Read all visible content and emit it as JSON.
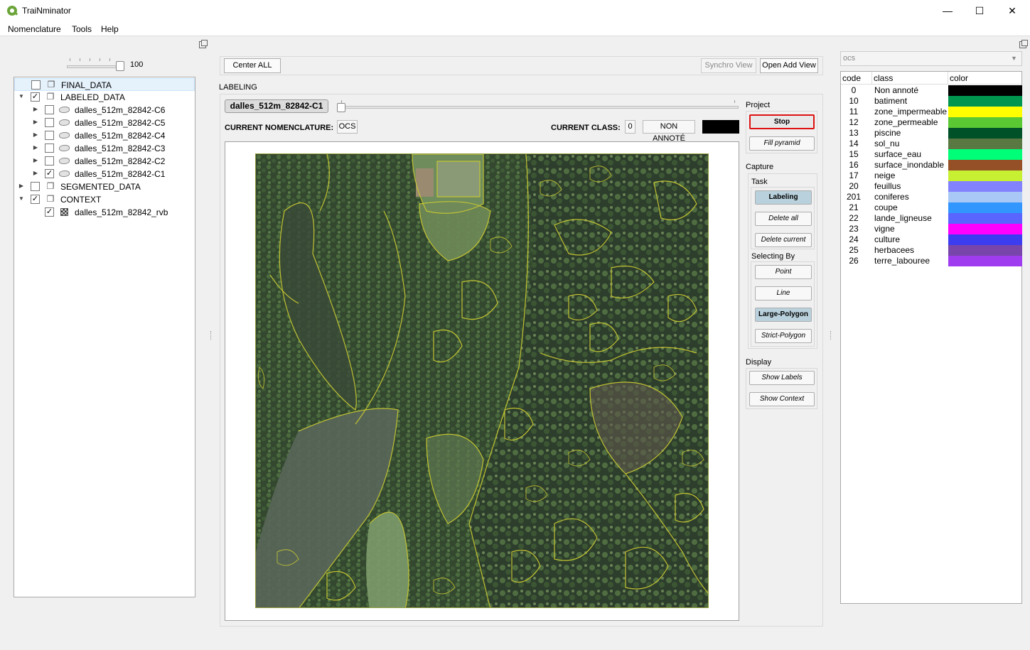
{
  "window": {
    "title": "TraiNminator",
    "minimize": "—",
    "maximize": "☐",
    "close": "✕"
  },
  "menu": {
    "items": [
      "Nomenclature",
      "Tools",
      "Help"
    ]
  },
  "layers_panel": {
    "opacity_value": "100",
    "opacity_fraction": 1.0,
    "items": [
      {
        "label": "FINAL_DATA",
        "checked": false
      },
      {
        "label": "LABELED_DATA",
        "checked": true
      },
      {
        "label": "dalles_512m_82842-C6",
        "checked": false
      },
      {
        "label": "dalles_512m_82842-C5",
        "checked": false
      },
      {
        "label": "dalles_512m_82842-C4",
        "checked": false
      },
      {
        "label": "dalles_512m_82842-C3",
        "checked": false
      },
      {
        "label": "dalles_512m_82842-C2",
        "checked": false
      },
      {
        "label": "dalles_512m_82842-C1",
        "checked": true
      },
      {
        "label": "SEGMENTED_DATA",
        "checked": false
      },
      {
        "label": "CONTEXT",
        "checked": true
      },
      {
        "label": "dalles_512m_82842_rvb",
        "checked": true
      }
    ]
  },
  "toolbar": {
    "center_all": "Center ALL",
    "synchro_view": "Synchro View",
    "open_add_view": "Open Add View"
  },
  "labeling": {
    "caption": "LABELING",
    "dalle_name": "dalles_512m_82842-C1",
    "dalle_position": 0.0,
    "current_nomenclature_label": "CURRENT NOMENCLATURE:",
    "current_nomenclature_value": "OCS",
    "current_class_label": "CURRENT CLASS:",
    "current_class_code": "0",
    "current_class_name": "NON ANNOTÉ",
    "current_class_color": "#000000"
  },
  "controls": {
    "project_label": "Project",
    "stop": "Stop",
    "fill_pyramid": "Fill pyramid",
    "capture_label": "Capture",
    "task_label": "Task",
    "labeling": "Labeling",
    "delete_all": "Delete all",
    "delete_current": "Delete current",
    "selecting_by_label": "Selecting By",
    "point": "Point",
    "line": "Line",
    "large_polygon": "Large-Polygon",
    "strict_polygon": "Strict-Polygon",
    "display_label": "Display",
    "show_labels": "Show Labels",
    "show_context": "Show Context"
  },
  "nomenclature_panel": {
    "selected": "ocs",
    "headers": {
      "code": "code",
      "class": "class",
      "color": "color"
    },
    "classes": [
      {
        "code": "0",
        "name": "Non annoté",
        "color": "#000000"
      },
      {
        "code": "10",
        "name": "batiment",
        "color": "#009650"
      },
      {
        "code": "11",
        "name": "zone_impermeable",
        "color": "#ffff00"
      },
      {
        "code": "12",
        "name": "zone_permeable",
        "color": "#5ac832"
      },
      {
        "code": "13",
        "name": "piscine",
        "color": "#005028"
      },
      {
        "code": "14",
        "name": "sol_nu",
        "color": "#5a7841"
      },
      {
        "code": "15",
        "name": "surface_eau",
        "color": "#00ff78"
      },
      {
        "code": "16",
        "name": "surface_inondable",
        "color": "#965028"
      },
      {
        "code": "17",
        "name": "neige",
        "color": "#c8f032"
      },
      {
        "code": "20",
        "name": "feuillus",
        "color": "#8282ff"
      },
      {
        "code": "201",
        "name": "coniferes",
        "color": "#aac8f5"
      },
      {
        "code": "21",
        "name": "coupe",
        "color": "#3296ff"
      },
      {
        "code": "22",
        "name": "lande_ligneuse",
        "color": "#5a64ff"
      },
      {
        "code": "23",
        "name": "vigne",
        "color": "#ff00ff"
      },
      {
        "code": "24",
        "name": "culture",
        "color": "#3c3cf0"
      },
      {
        "code": "25",
        "name": "herbacees",
        "color": "#7846aa"
      },
      {
        "code": "26",
        "name": "terre_labouree",
        "color": "#a03cf0"
      }
    ]
  },
  "colors": {
    "highlight_border": "#dd1111",
    "active_tool": "#b9d1dc",
    "polygon_outline": "#c8c832"
  }
}
